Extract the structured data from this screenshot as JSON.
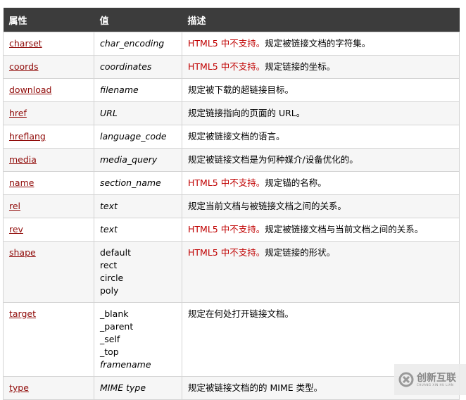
{
  "headers": [
    "属性",
    "值",
    "描述"
  ],
  "rows": [
    {
      "attr": "charset",
      "values": [
        "char_encoding"
      ],
      "italic": [
        true
      ],
      "unsupported": "HTML5 中不支持。",
      "desc": "规定被链接文档的字符集。"
    },
    {
      "attr": "coords",
      "values": [
        "coordinates"
      ],
      "italic": [
        true
      ],
      "unsupported": "HTML5 中不支持。",
      "desc": "规定链接的坐标。"
    },
    {
      "attr": "download",
      "values": [
        "filename"
      ],
      "italic": [
        true
      ],
      "unsupported": "",
      "desc": "规定被下载的超链接目标。"
    },
    {
      "attr": "href",
      "values": [
        "URL"
      ],
      "italic": [
        true
      ],
      "unsupported": "",
      "desc": "规定链接指向的页面的 URL。"
    },
    {
      "attr": "hreflang",
      "values": [
        "language_code"
      ],
      "italic": [
        true
      ],
      "unsupported": "",
      "desc": "规定被链接文档的语言。"
    },
    {
      "attr": "media",
      "values": [
        "media_query"
      ],
      "italic": [
        true
      ],
      "unsupported": "",
      "desc": "规定被链接文档是为何种媒介/设备优化的。"
    },
    {
      "attr": "name",
      "values": [
        "section_name"
      ],
      "italic": [
        true
      ],
      "unsupported": "HTML5 中不支持。",
      "desc": "规定锚的名称。"
    },
    {
      "attr": "rel",
      "values": [
        "text"
      ],
      "italic": [
        true
      ],
      "unsupported": "",
      "desc": "规定当前文档与被链接文档之间的关系。"
    },
    {
      "attr": "rev",
      "values": [
        "text"
      ],
      "italic": [
        true
      ],
      "unsupported": "HTML5 中不支持。",
      "desc": "规定被链接文档与当前文档之间的关系。"
    },
    {
      "attr": "shape",
      "values": [
        "default",
        "rect",
        "circle",
        "poly"
      ],
      "italic": [
        false,
        false,
        false,
        false
      ],
      "unsupported": "HTML5 中不支持。",
      "desc": "规定链接的形状。"
    },
    {
      "attr": "target",
      "values": [
        "_blank",
        "_parent",
        "_self",
        "_top",
        "framename"
      ],
      "italic": [
        false,
        false,
        false,
        false,
        true
      ],
      "unsupported": "",
      "desc": "规定在何处打开链接文档。"
    },
    {
      "attr": "type",
      "values": [
        "MIME type"
      ],
      "italic": [
        true
      ],
      "unsupported": "",
      "desc": "规定被链接文档的的 MIME 类型。"
    }
  ],
  "colors": {
    "header_bg": "#3c3c3c",
    "link": "#900b09",
    "unsupported": "#c00000",
    "alt_row": "#f6f6f6"
  },
  "watermark": {
    "text": "创新互联",
    "subtext": "CHUANG XIN HU LIAN",
    "icon": "chuangxin-logo-icon"
  }
}
